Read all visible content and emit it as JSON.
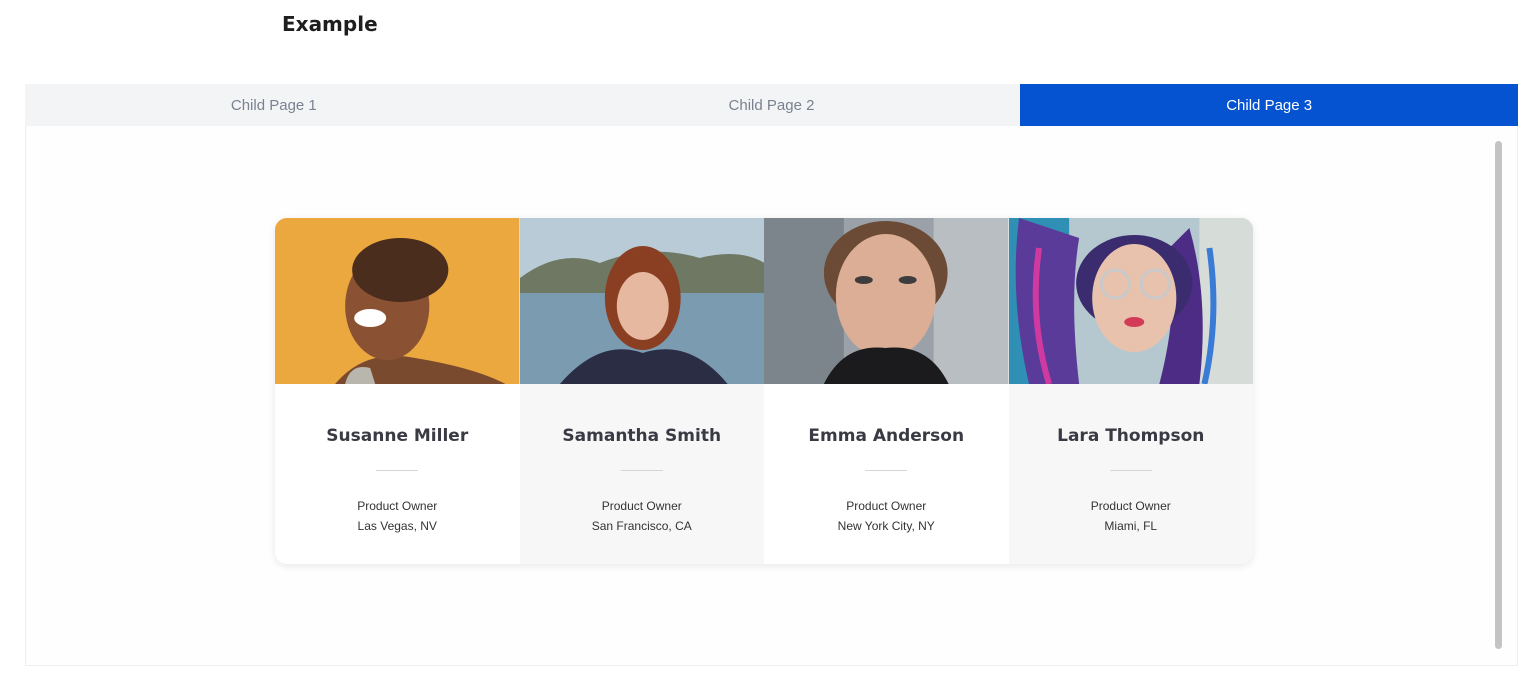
{
  "page": {
    "title": "Example"
  },
  "tabs": [
    {
      "label": "Child Page 1",
      "active": false
    },
    {
      "label": "Child Page 2",
      "active": false
    },
    {
      "label": "Child Page 3",
      "active": true
    }
  ],
  "colors": {
    "accent": "#0553d1",
    "tab_bg": "#f3f4f6"
  },
  "team": [
    {
      "name": "Susanne Miller",
      "role": "Product Owner",
      "location": "Las Vegas, NV",
      "photo": "laughing-woman-portrait"
    },
    {
      "name": "Samantha Smith",
      "role": "Product Owner",
      "location": "San Francisco, CA",
      "photo": "redhead-woman-portrait"
    },
    {
      "name": "Emma Anderson",
      "role": "Product Owner",
      "location": "New York City, NY",
      "photo": "woman-closeup-portrait"
    },
    {
      "name": "Lara Thompson",
      "role": "Product Owner",
      "location": "Miami, FL",
      "photo": "woman-braids-glasses-portrait"
    }
  ]
}
